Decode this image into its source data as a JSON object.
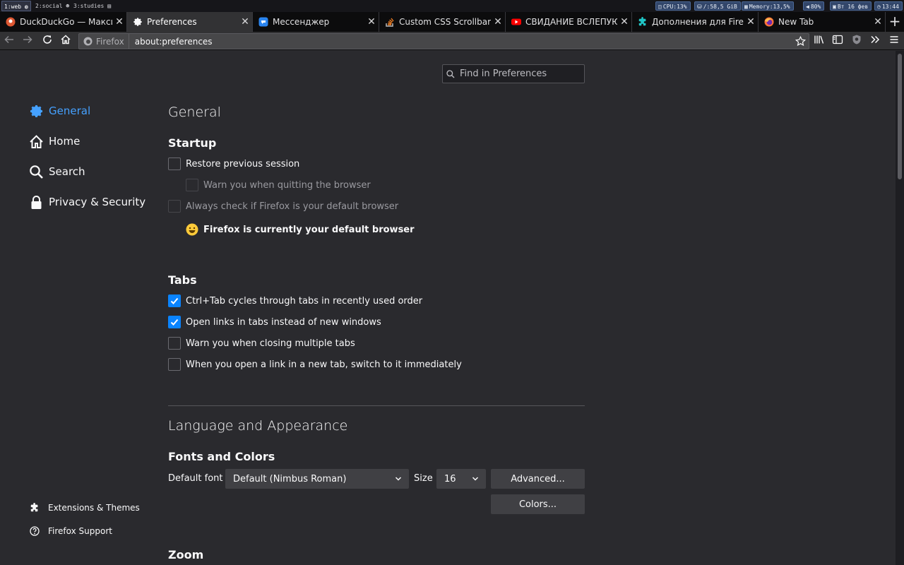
{
  "statusbar": {
    "workspaces": [
      "1:web",
      "2:social",
      "3:studies"
    ],
    "cpu": "CPU:13%",
    "disk": "/:58,5 GiB",
    "memory": "Memory:13,5%",
    "volume": "80%",
    "date": "Вт 16 фев",
    "time": "13:44"
  },
  "tabs": [
    {
      "title": "DuckDuckGo — Макси",
      "icon": "duckduckgo-icon"
    },
    {
      "title": "Preferences",
      "icon": "gear-icon"
    },
    {
      "title": "Мессенджер",
      "icon": "messenger-icon"
    },
    {
      "title": "Custom CSS Scrollbar f",
      "icon": "stackoverflow-icon"
    },
    {
      "title": "СВИДАНИЕ ВСЛЕПУЮ",
      "icon": "youtube-icon"
    },
    {
      "title": "Дополнения для Firef",
      "icon": "puzzle-icon"
    },
    {
      "title": "New Tab",
      "icon": "firefox-icon"
    }
  ],
  "navbar": {
    "identity_label": "Firefox",
    "url": "about:preferences"
  },
  "search": {
    "placeholder": "Find in Preferences"
  },
  "sidebar": {
    "items": [
      {
        "label": "General",
        "icon": "gear-icon"
      },
      {
        "label": "Home",
        "icon": "home-icon"
      },
      {
        "label": "Search",
        "icon": "search-icon"
      },
      {
        "label": "Privacy & Security",
        "icon": "lock-icon"
      }
    ],
    "footer": [
      {
        "label": "Extensions & Themes",
        "icon": "puzzle-icon"
      },
      {
        "label": "Firefox Support",
        "icon": "help-icon"
      }
    ]
  },
  "main": {
    "title": "General",
    "startup": {
      "heading": "Startup",
      "restore": "Restore previous session",
      "warn_quit": "Warn you when quitting the browser",
      "always_check": "Always check if Firefox is your default browser",
      "default_status": "Firefox is currently your default browser"
    },
    "tabs_section": {
      "heading": "Tabs",
      "ctrl_tab": "Ctrl+Tab cycles through tabs in recently used order",
      "open_links": "Open links in tabs instead of new windows",
      "warn_close": "Warn you when closing multiple tabs",
      "switch_to": "When you open a link in a new tab, switch to it immediately"
    },
    "language": {
      "title": "Language and Appearance",
      "fonts_heading": "Fonts and Colors",
      "default_font_label": "Default font",
      "default_font_value": "Default (Nimbus Roman)",
      "size_label": "Size",
      "size_value": "16",
      "advanced_button": "Advanced...",
      "colors_button": "Colors..."
    },
    "zoom_heading": "Zoom"
  },
  "colors": {
    "accent": "#0a84ff",
    "selected_category": "#45a1ff",
    "background": "#2a2a2e",
    "tabstrip": "#0c0c0d"
  }
}
